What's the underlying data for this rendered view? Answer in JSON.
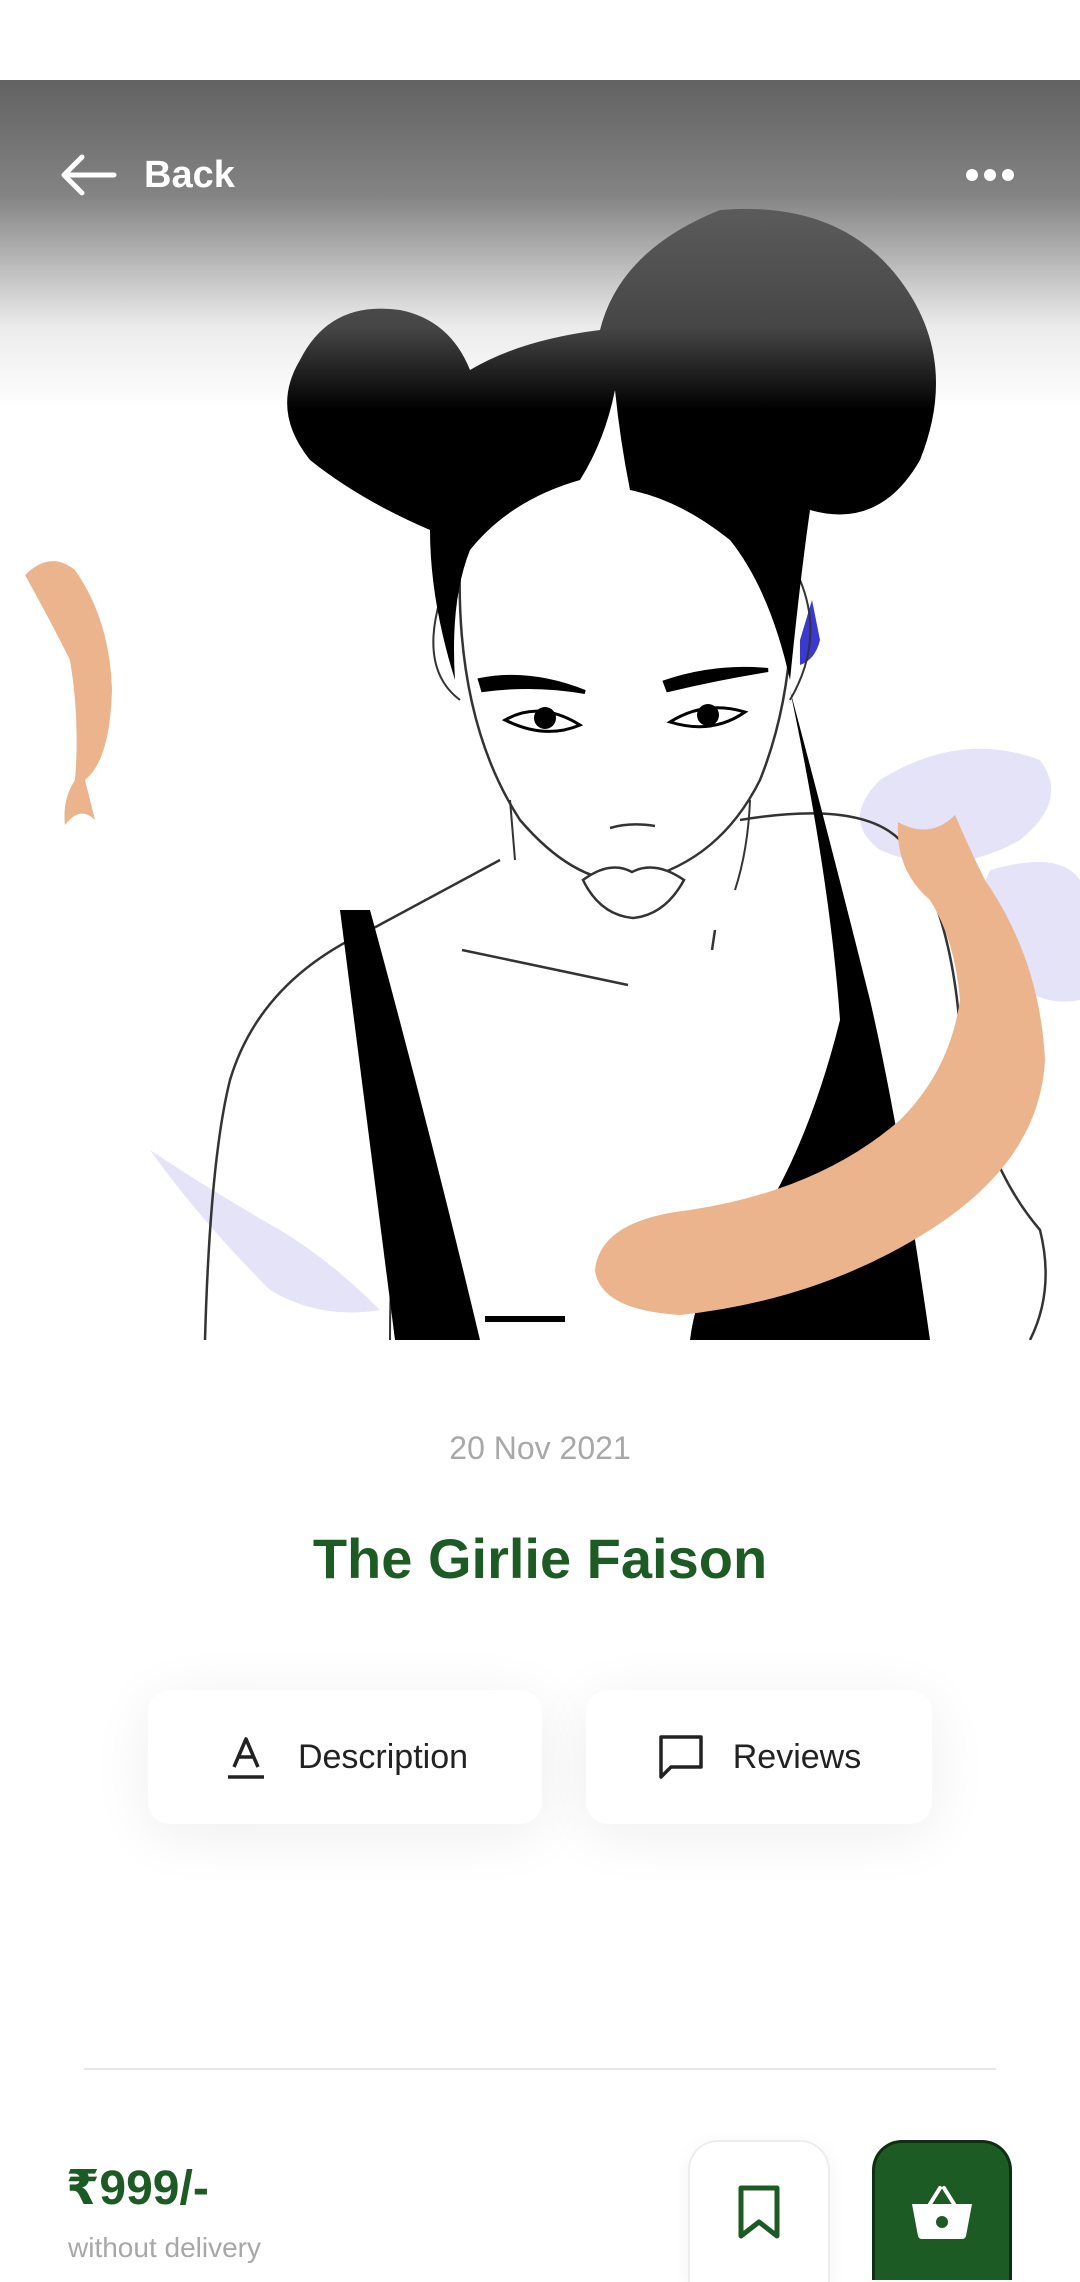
{
  "header": {
    "back_label": "Back",
    "back_icon": "arrow-left-icon",
    "more_icon": "more-horizontal-icon"
  },
  "product": {
    "date": "20 Nov 2021",
    "title": "The Girlie Faison",
    "price": "₹999/-",
    "price_note": "without delivery"
  },
  "tabs": [
    {
      "label": "Description",
      "icon": "text-format-icon"
    },
    {
      "label": "Reviews",
      "icon": "message-square-icon"
    }
  ],
  "actions": {
    "bookmark_icon": "bookmark-icon",
    "cart_icon": "basket-icon"
  },
  "colors": {
    "brand_green": "#1d5b24",
    "muted_text": "#a8a8a8",
    "fish_peach": "#ebb48d",
    "accent_lavender": "#e3e1f7"
  }
}
